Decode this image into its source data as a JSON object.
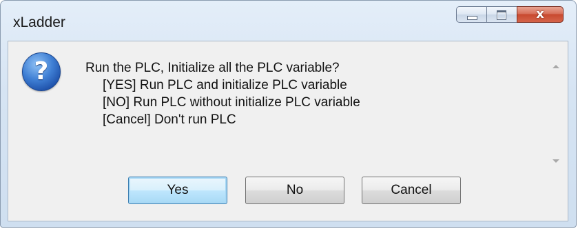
{
  "window": {
    "title": "xLadder",
    "close_glyph": "x"
  },
  "dialog": {
    "icon": "question-icon",
    "icon_glyph": "?",
    "message_lines": [
      "Run the PLC, Initialize all the PLC variable?",
      "[YES] Run PLC and initialize PLC variable",
      "[NO] Run PLC without initialize PLC variable",
      "[Cancel] Don't run PLC"
    ]
  },
  "buttons": {
    "yes_label": "Yes",
    "no_label": "No",
    "cancel_label": "Cancel"
  },
  "colors": {
    "title_bar": "#d6e4f3",
    "close_button": "#c8492f",
    "default_button_border": "#3c7fb1"
  }
}
